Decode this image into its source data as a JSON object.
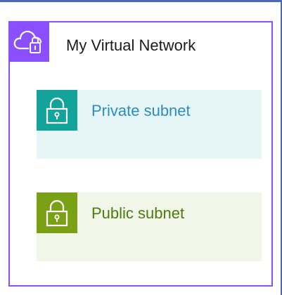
{
  "network": {
    "title": "My Virtual Network",
    "icon": "cloud-lock-icon",
    "color": "#8c4fff"
  },
  "subnets": [
    {
      "label": "Private subnet",
      "icon": "padlock-icon",
      "accent": "#13a39b",
      "label_color": "#2b8cc4",
      "fill": "#e6f6f7"
    },
    {
      "label": "Public subnet",
      "icon": "padlock-icon",
      "accent": "#7aa116",
      "label_color": "#4c7a0e",
      "fill": "#f2f6e9"
    }
  ],
  "frame_color": "#4a67b8"
}
